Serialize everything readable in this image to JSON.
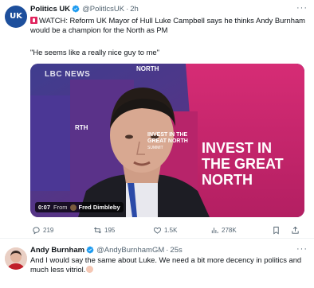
{
  "tweet1": {
    "avatar_text": "UK",
    "author_name": "Politics UK",
    "author_handle": "@PolitlcsUK",
    "separator": "·",
    "time": "2h",
    "more_label": "···",
    "line1": "WATCH: Reform UK Mayor of Hull Luke Campbell says he thinks Andy Burnham would be a champion for the North as PM",
    "line2": "\"He seems like a really nice guy to me\"",
    "video": {
      "watermark": "LBC NEWS",
      "banner_left": "RTH",
      "banner_mid": "NORTH",
      "banner_main": "INVEST IN THE GREAT NORTH",
      "small_banner": "INVEST IN THE GREAT NORTH",
      "small_banner_sub": "SUMMIT",
      "duration": "0:07",
      "from_label": "From",
      "source_name": "Fred Dimbleby"
    },
    "actions": {
      "replies": "219",
      "retweets": "195",
      "likes": "1.5K",
      "views": "278K"
    }
  },
  "tweet2": {
    "author_name": "Andy Burnham",
    "author_handle": "@AndyBurnhamGM",
    "separator": "·",
    "time": "25s",
    "more_label": "···",
    "text": "And I would say the same about Luke. We need a bit more decency in politics and much less vitriol."
  },
  "colors": {
    "verified": "#1d9bf0",
    "secondary_text": "#536471",
    "primary_text": "#0f1419",
    "video_bg": "#6e2d84",
    "banner_pink": "#d6246e"
  },
  "icons": [
    "verified-badge-icon",
    "siren-icon",
    "reply-icon",
    "retweet-icon",
    "like-icon",
    "views-icon",
    "bookmark-icon",
    "share-icon",
    "clapping-hands-icon"
  ]
}
